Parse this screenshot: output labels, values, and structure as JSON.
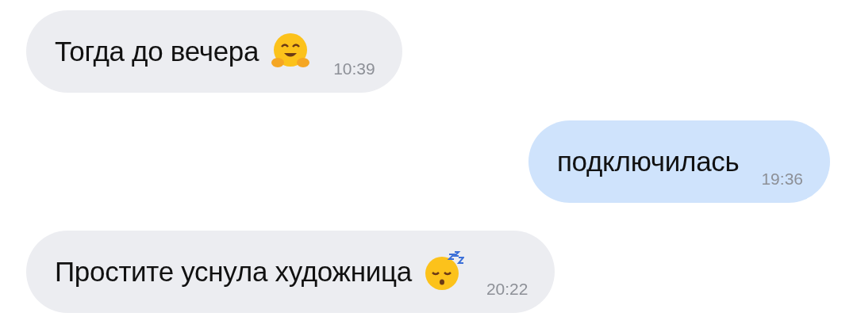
{
  "messages": [
    {
      "kind": "incoming",
      "text": "Тогда до вечера",
      "emoji": {
        "kind": "hugging"
      },
      "time": "10:39"
    },
    {
      "kind": "outgoing",
      "text": "подключилась",
      "time": "19:36"
    },
    {
      "kind": "incoming",
      "text": "Простите уснула художница",
      "emoji": {
        "kind": "sleeping"
      },
      "time": "20:22"
    }
  ]
}
